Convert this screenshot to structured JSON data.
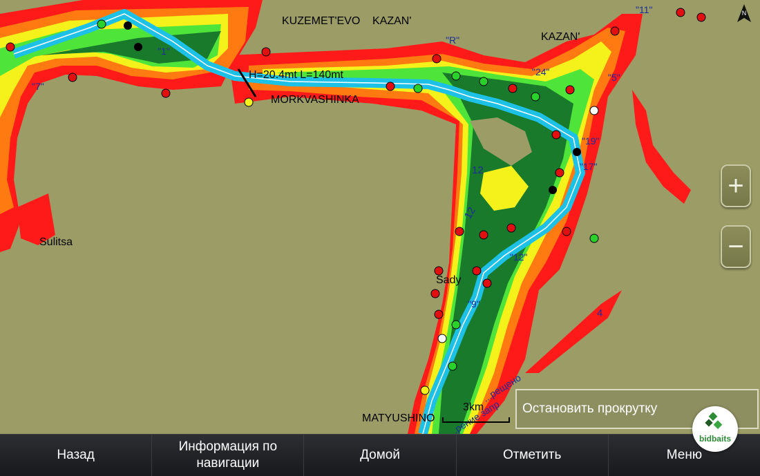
{
  "map": {
    "places": {
      "kuzemetevo": "KUZEMET'EVO",
      "kazan_upper": "KAZAN'",
      "kazan_right": "KAZAN'",
      "morkvashinka": "MORKVASHINKA",
      "sulitsa": "Sulitsa",
      "sady": "Sady",
      "matyushino": "MATYUSHINO"
    },
    "bridge_label": "H=20.4mt L=140mt",
    "buoys": [
      "\"11\"",
      "\"R\"",
      "\"1\"",
      "\"7\"",
      "\"24\"",
      "\"5\"",
      "\"19\"",
      "\"17\"",
      "\"12\"",
      "\"9\""
    ],
    "depths": [
      "12",
      "12",
      "4"
    ],
    "restricted_text": "...рещено",
    "restricted_text_lower": "...рение запр",
    "scale": "3km"
  },
  "icons": {
    "compass": "north-arrow-icon",
    "zoom_in": "plus-icon",
    "zoom_out": "minus-icon"
  },
  "zoom": {
    "in_label": "+",
    "out_label": "−"
  },
  "compass_label": "N",
  "scroll_button": "Остановить прокрутку",
  "logo": "bidbaits",
  "bottom_bar": {
    "back": "Назад",
    "nav_info": "Информация по навигации",
    "home": "Домой",
    "mark": "Отметить",
    "menu": "Меню"
  },
  "colors": {
    "land": "#9c9d66",
    "deep": "#1a7a2c",
    "mid": "#4fe43a",
    "shallow": "#f5f21b",
    "shoal": "#ff7a10",
    "danger": "#ff1a1a",
    "channel": "#1ec1e6"
  }
}
